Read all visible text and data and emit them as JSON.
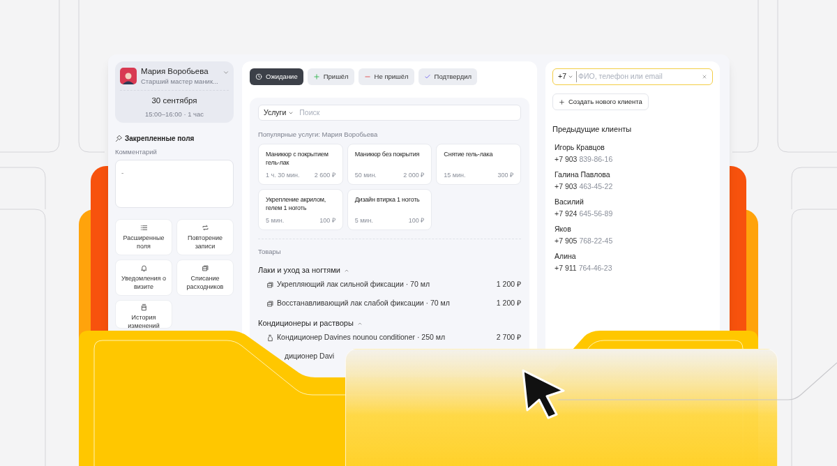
{
  "staff": {
    "name": "Мария Воробьева",
    "role": "Старший мастер маник...",
    "date": "30 сентября",
    "time": "15:00–16:00 · 1 час"
  },
  "pinned": {
    "title": "Закрепленные поля",
    "comment_label": "Комментарий",
    "comment_value": "-"
  },
  "actions": [
    {
      "label": "Расширенные поля",
      "kind": "list"
    },
    {
      "label": "Повторение записи",
      "kind": "repeat"
    },
    {
      "label": "Уведомления о визите",
      "kind": "bell"
    },
    {
      "label": "Списание расходников",
      "kind": "box"
    },
    {
      "label": "История изменений",
      "kind": "jar"
    }
  ],
  "status_buttons": [
    {
      "label": "Ожидание",
      "kind": "waiting",
      "selected": true
    },
    {
      "label": "Пришёл",
      "kind": "arrived",
      "selected": false
    },
    {
      "label": "Не пришёл",
      "kind": "no_show",
      "selected": false
    },
    {
      "label": "Подтвердил",
      "kind": "confirmed",
      "selected": false
    }
  ],
  "services": {
    "category": "Услуги",
    "search_placeholder": "Поиск",
    "popular_title": "Популярные услуги: Мария Воробьева",
    "items": [
      {
        "name": "Маникюр с покрытием гель-лак",
        "duration": "1 ч. 30 мин.",
        "price": "2 600 ₽"
      },
      {
        "name": "Маникюр без покрытия",
        "duration": "50 мин.",
        "price": "2 000 ₽"
      },
      {
        "name": "Снятие гель-лака",
        "duration": "15 мин.",
        "price": "300 ₽"
      },
      {
        "name": "Укрепление акрилом, гелем 1 ноготь",
        "duration": "5 мин.",
        "price": "100 ₽"
      },
      {
        "name": "Дизайн втирка 1 ноготь",
        "duration": "5 мин.",
        "price": "100 ₽"
      }
    ]
  },
  "products": {
    "title": "Товары",
    "groups": [
      {
        "name": "Лаки и уход за ногтями",
        "expanded": true,
        "items": [
          {
            "kind": "polish",
            "name": "Укрепляющий лак сильной фиксации · 70 мл",
            "price": "1 200 ₽"
          },
          {
            "kind": "polish",
            "name": "Восстанавливающий лак слабой фиксации · 70 мл",
            "price": "1 200 ₽"
          }
        ]
      },
      {
        "name": "Кондиционеры и растворы",
        "expanded": true,
        "items": [
          {
            "kind": "conditioner",
            "name": "Кондиционер Davines nounou conditioner · 250 мл",
            "price": "2 700 ₽"
          },
          {
            "name": "диционер Davi"
          }
        ]
      }
    ]
  },
  "client": {
    "country_code": "+7",
    "placeholder": "ФИО, телефон или email",
    "create_button": "Создать нового клиента",
    "previous_title": "Предыдущие клиенты",
    "clients": [
      {
        "name": "Игорь Кравцов",
        "phone_prefix": "+7 903",
        "phone_number": "839-86-16"
      },
      {
        "name": "Галина Павлова",
        "phone_prefix": "+7 903",
        "phone_number": "463-45-22"
      },
      {
        "name": "Василий",
        "phone_prefix": "+7 924",
        "phone_number": "645-56-89"
      },
      {
        "name": "Яков",
        "phone_prefix": "+7 905",
        "phone_number": "768-22-45"
      },
      {
        "name": "Алина",
        "phone_prefix": "+7 911",
        "phone_number": "764-46-23"
      }
    ]
  }
}
